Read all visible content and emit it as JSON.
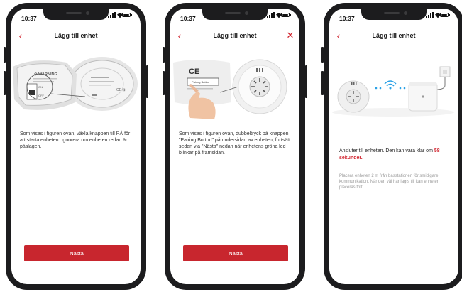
{
  "screens": [
    {
      "status_time": "10:37",
      "title": "Lägg till enhet",
      "instruction": "Som visas i figuren ovan, växla knappen till PÅ för att starta enheten. Ignorera om enheten redan är påslagen.",
      "button": "Nästa",
      "illustration": {
        "device_label": "⊙ WARNING",
        "switch_labels": [
          "ON",
          "OFF"
        ],
        "cert_marks": "CE ⊠"
      }
    },
    {
      "status_time": "10:37",
      "title": "Lägg till enhet",
      "instruction": "Som visas i figuren ovan, dubbeltryck på knappen \"Pairing Button\" på undersidan av enheten, fortsätt sedan via \"Nästa\" nedan när enhetens gröna led blinkar på framsidan.",
      "button": "Nästa",
      "illustration": {
        "cert_marks": "CE",
        "button_label": "Pairing Button"
      }
    },
    {
      "status_time": "10:37",
      "title": "Lägg till enhet",
      "status_text": "Ansluter till enheten. Den kan vara klar om",
      "countdown": "58 sekunder.",
      "hint": "Placera enheten 2 m från basstationen för smidigare kommunikation. När den väl har lagts till kan enheten placeras fritt."
    }
  ],
  "colors": {
    "accent": "#c8262e",
    "back_arrow": "#d0202b",
    "phone_frame": "#1c1c1e",
    "wifi": "#2aa1e6"
  },
  "icons": [
    "back-arrow-icon",
    "close-icon",
    "wifi-icon",
    "signal-icon",
    "battery-icon"
  ]
}
